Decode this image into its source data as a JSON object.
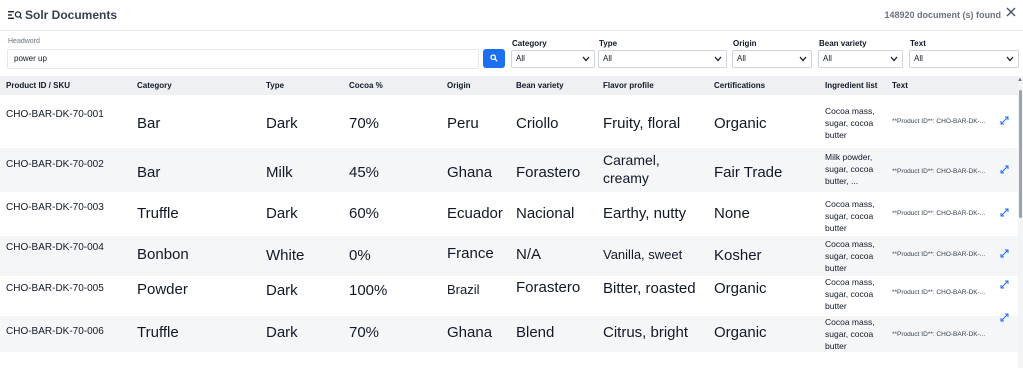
{
  "header": {
    "title": "Solr Documents",
    "count_text": "148920 document (s) found"
  },
  "filters": {
    "headword_label": "Headword",
    "headword_value": "power up",
    "category_label": "Category",
    "category_value": "All",
    "type_label": "Type",
    "type_value": "All",
    "origin_label": "Origin",
    "origin_value": "All",
    "bean_label": "Bean variety",
    "bean_value": "All",
    "text_label": "Text",
    "text_value": "All"
  },
  "table": {
    "columns": [
      "Product ID / SKU",
      "Category",
      "Type",
      "Cocoa %",
      "Origin",
      "Bean variety",
      "Flavor profile",
      "Certifications",
      "Ingredient list",
      "Text"
    ],
    "rows": [
      {
        "sku": "CHO-BAR-DK-70-001",
        "category": "Bar",
        "type": "Dark",
        "cocoa": "70%",
        "origin": "Peru",
        "bean": "Criollo",
        "flavor": "Fruity, floral",
        "cert": "Organic",
        "ingredients": "Cocoa mass, sugar, cocoa butter",
        "text": "**Product ID**: CHO-BAR-DK-..."
      },
      {
        "sku": "CHO-BAR-DK-70-002",
        "category": "Bar",
        "type": "Milk",
        "cocoa": "45%",
        "origin": "Ghana",
        "bean": "Forastero",
        "flavor": "Caramel, creamy",
        "cert": "Fair Trade",
        "ingredients": "Milk powder, sugar, cocoa butter, ...",
        "text": "**Product ID**: CHO-BAR-DK-..."
      },
      {
        "sku": "CHO-BAR-DK-70-003",
        "category": "Truffle",
        "type": "Dark",
        "cocoa": "60%",
        "origin": "Ecuador",
        "bean": "Nacional",
        "flavor": "Earthy, nutty",
        "cert": "None",
        "ingredients": "Cocoa mass, sugar, cocoa butter",
        "text": "**Product ID**: CHO-BAR-DK-..."
      },
      {
        "sku": "CHO-BAR-DK-70-004",
        "category": "Bonbon",
        "type": "White",
        "cocoa": "0%",
        "origin": "France",
        "bean": "N/A",
        "flavor": "Vanilla, sweet",
        "cert": "Kosher",
        "ingredients": "Cocoa mass, sugar, cocoa butter",
        "text": "**Product ID**: CHO-BAR-DK-..."
      },
      {
        "sku": "CHO-BAR-DK-70-005",
        "category": "Powder",
        "type": "Dark",
        "cocoa": "100%",
        "origin": "Brazil",
        "bean": "Forastero",
        "flavor": "Bitter, roasted",
        "cert": "Organic",
        "ingredients": "Cocoa mass, sugar, cocoa butter",
        "text": "**Product ID**: CHO-BAR-DK-..."
      },
      {
        "sku": "CHO-BAR-DK-70-006",
        "category": "Truffle",
        "type": "Dark",
        "cocoa": "70%",
        "origin": "Ghana",
        "bean": "Blend",
        "flavor": "Citrus, bright",
        "cert": "Organic",
        "ingredients": "Cocoa mass, sugar, cocoa butter",
        "text": "**Product ID**: CHO-BAR-DK-..."
      }
    ]
  },
  "icons": {
    "menu": "list-search-icon",
    "close": "close-icon",
    "search": "search-icon",
    "expand": "expand-icon",
    "dropdown": "chevron-down-icon"
  },
  "colors": {
    "accent": "#1d6ff2",
    "header_bg": "#eef0f3",
    "alt_row_bg": "#f5f6f8"
  }
}
